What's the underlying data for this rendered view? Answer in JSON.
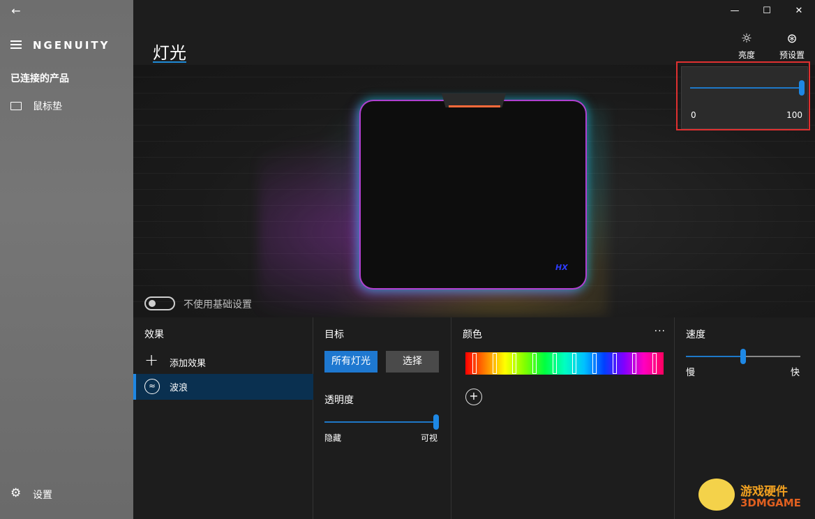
{
  "sidebar": {
    "back_icon": "arrow-left-icon",
    "brand": "NGENUITY",
    "section_title": "已连接的产品",
    "product_label": "鼠标垫",
    "settings_label": "设置"
  },
  "window": {
    "minimize": "—",
    "maximize": "☐",
    "close": "✕"
  },
  "main": {
    "page_title": "灯光",
    "tools": {
      "brightness_label": "亮度",
      "preset_label": "预设置"
    },
    "brightness_popup": {
      "min": "0",
      "max": "100",
      "value": 100
    },
    "toggle_label": "不使用基础设置",
    "toggle_on": false
  },
  "effects": {
    "title": "效果",
    "add_label": "添加效果",
    "items": [
      {
        "label": "波浪",
        "selected": true
      }
    ]
  },
  "target": {
    "title": "目标",
    "all_lights": "所有灯光",
    "select": "选择",
    "opacity_title": "透明度",
    "opacity_min": "隐藏",
    "opacity_max": "可视",
    "opacity_value": 100
  },
  "color": {
    "title": "颜色",
    "more": "···",
    "add": "+",
    "stop_count": 10
  },
  "speed": {
    "title": "速度",
    "slow": "慢",
    "fast": "快",
    "value": 50
  },
  "watermark": {
    "line1": "游戏硬件",
    "line2": "3DMGAME"
  },
  "colors": {
    "accent": "#1e78d0",
    "highlight": "#e03030",
    "selected_bg": "#0a3050"
  }
}
